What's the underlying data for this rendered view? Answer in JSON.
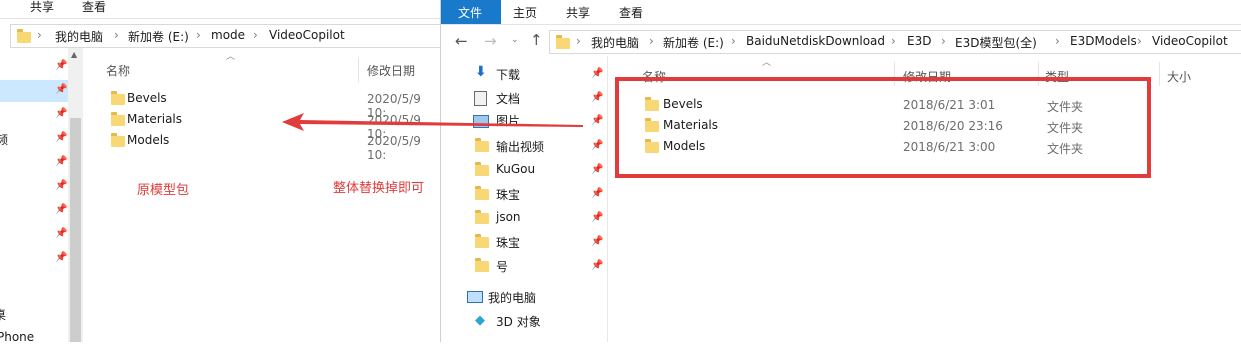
{
  "left": {
    "ribbon_tabs": [
      "共享",
      "查看"
    ],
    "breadcrumb": [
      "我的电脑",
      "新加卷 (E:)",
      "mode",
      "VideoCopilot"
    ],
    "col_name": "名称",
    "col_date": "修改日期",
    "files": [
      {
        "name": "Bevels",
        "date": "2020/5/9 10:"
      },
      {
        "name": "Materials",
        "date": "2020/5/9 10:"
      },
      {
        "name": "Models",
        "date": "2020/5/9 10:"
      }
    ],
    "nav_partial": [
      "频",
      "桌",
      "Phone"
    ]
  },
  "right": {
    "ribbon_tabs": [
      "文件",
      "主页",
      "共享",
      "查看"
    ],
    "breadcrumb": [
      "我的电脑",
      "新加卷 (E:)",
      "BaiduNetdiskDownload",
      "E3D",
      "E3D模型包(全)",
      "E3DModels",
      "VideoCopilot"
    ],
    "nav_items": [
      "下载",
      "文档",
      "图片",
      "输出视频",
      "KuGou",
      "珠宝",
      "json",
      "珠宝",
      "号"
    ],
    "nav_this_pc": "我的电脑",
    "nav_3d": "3D 对象",
    "col_name": "名称",
    "col_date": "修改日期",
    "col_type": "类型",
    "col_size": "大小",
    "files": [
      {
        "name": "Bevels",
        "date": "2018/6/21 3:01",
        "type": "文件夹"
      },
      {
        "name": "Materials",
        "date": "2018/6/20 23:16",
        "type": "文件夹"
      },
      {
        "name": "Models",
        "date": "2018/6/21 3:00",
        "type": "文件夹"
      }
    ]
  },
  "annotations": {
    "original_label": "原模型包",
    "replace_label": "整体替换掉即可",
    "accent_color": "#e23b3b"
  }
}
